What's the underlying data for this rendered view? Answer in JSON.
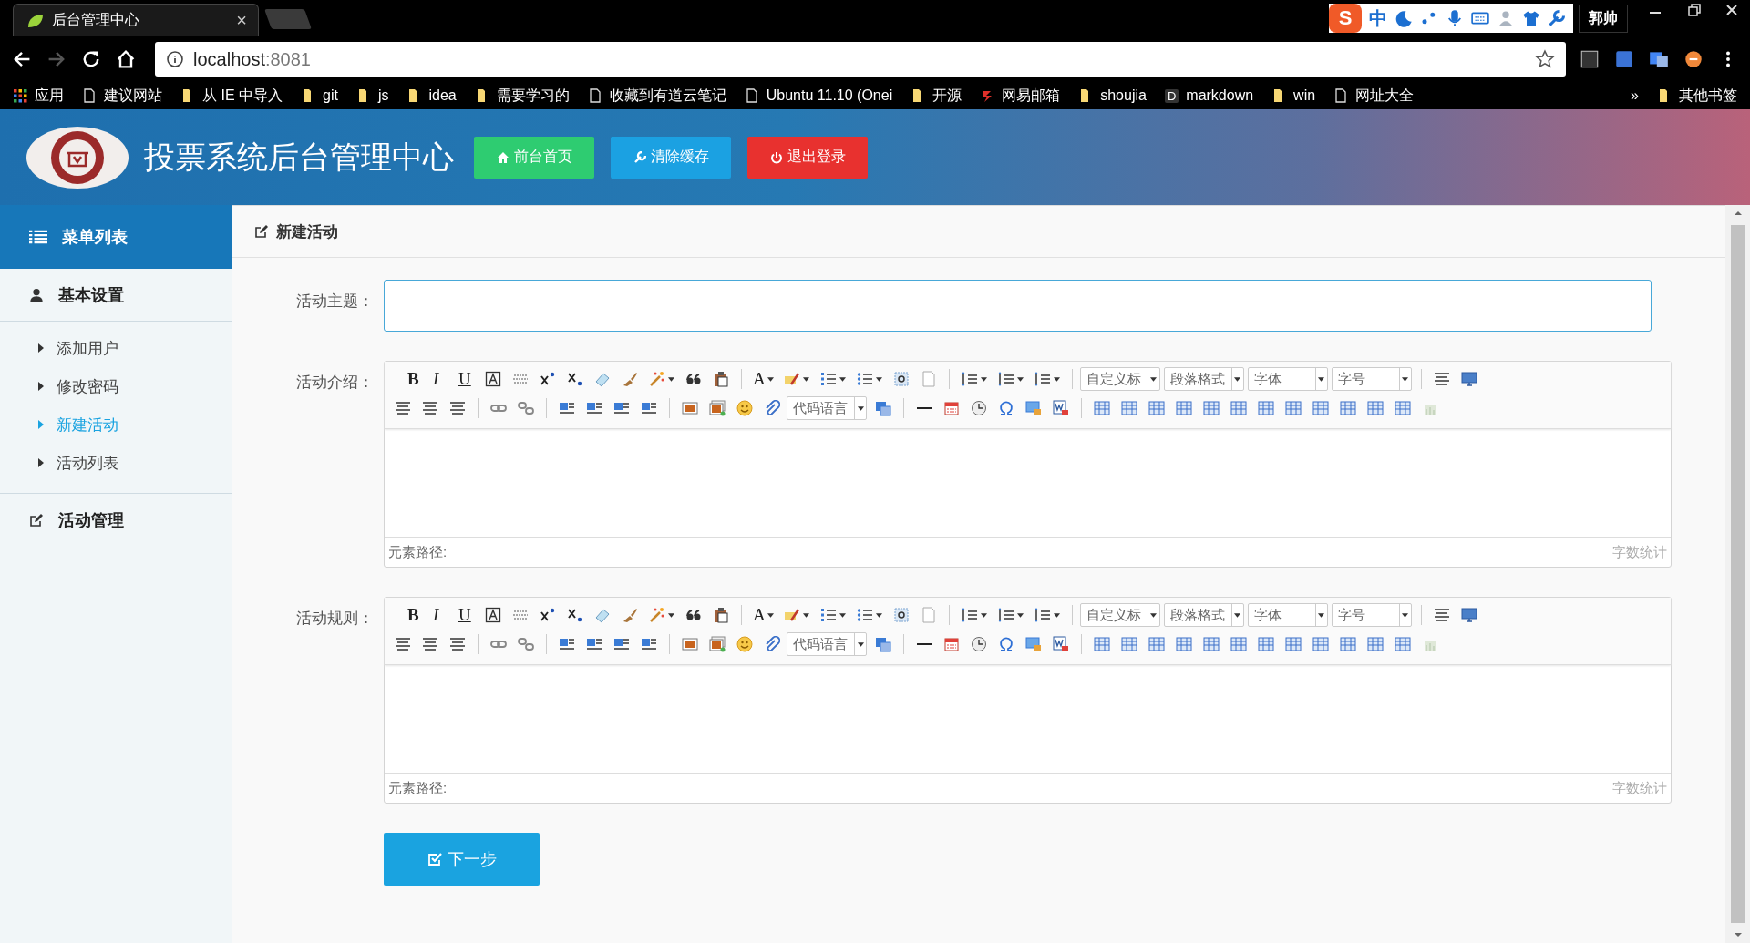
{
  "browser": {
    "tab": {
      "title": "后台管理中心",
      "close": "×"
    },
    "address": {
      "host": "localhost",
      "port": ":8081"
    },
    "bookmarks": [
      {
        "kind": "apps",
        "label": "应用"
      },
      {
        "kind": "page",
        "label": "建议网站"
      },
      {
        "kind": "folder",
        "label": "从 IE 中导入"
      },
      {
        "kind": "folder",
        "label": "git"
      },
      {
        "kind": "folder",
        "label": "js"
      },
      {
        "kind": "folder",
        "label": "idea"
      },
      {
        "kind": "folder",
        "label": "需要学习的"
      },
      {
        "kind": "page",
        "label": "收藏到有道云笔记"
      },
      {
        "kind": "page",
        "label": "Ubuntu 11.10 (Onei"
      },
      {
        "kind": "folder",
        "label": "开源"
      },
      {
        "kind": "mail",
        "label": "网易邮箱"
      },
      {
        "kind": "folder",
        "label": "shoujia"
      },
      {
        "kind": "letter",
        "glyph": "D",
        "label": "markdown"
      },
      {
        "kind": "folder",
        "label": "win"
      },
      {
        "kind": "page",
        "label": "网址大全"
      }
    ],
    "more": "»",
    "other_bookmarks": "其他书签",
    "ime": {
      "logo": "S",
      "mode": "中"
    },
    "user": "郭帅"
  },
  "header": {
    "title": "投票系统后台管理中心",
    "buttons": [
      {
        "label": "前台首页",
        "color": "#2ecc71"
      },
      {
        "label": "清除缓存",
        "color": "#1ba1e2"
      },
      {
        "label": "退出登录",
        "color": "#e8312f"
      }
    ]
  },
  "sidebar": {
    "title": "菜单列表",
    "sections": [
      {
        "label": "基本设置",
        "expanded": true,
        "items": [
          {
            "label": "添加用户",
            "selected": false
          },
          {
            "label": "修改密码",
            "selected": false
          },
          {
            "label": "新建活动",
            "selected": true
          },
          {
            "label": "活动列表",
            "selected": false
          }
        ]
      },
      {
        "label": "活动管理",
        "expanded": false
      }
    ]
  },
  "panel": {
    "title": "新建活动",
    "subject": {
      "label": "活动主题："
    },
    "editors": [
      {
        "label": "活动介绍：",
        "path": "元素路径:",
        "count": "字数统计",
        "rows": [
          [
            {
              "kind": "sep"
            },
            {
              "kind": "glyph",
              "text": "B",
              "caret": false
            },
            {
              "kind": "glyph",
              "text": "I",
              "caret": false
            },
            {
              "kind": "glyph",
              "text": "U",
              "caret": false
            },
            {
              "kind": "icon",
              "caret": false
            },
            {
              "kind": "icon",
              "caret": false
            },
            {
              "kind": "icon",
              "caret": false
            },
            {
              "kind": "icon",
              "caret": false
            },
            {
              "kind": "icon",
              "caret": false
            },
            {
              "kind": "icon",
              "caret": false
            },
            {
              "kind": "icon",
              "caret": true
            },
            {
              "kind": "icon",
              "caret": false
            },
            {
              "kind": "icon",
              "caret": false
            },
            {
              "kind": "sep"
            },
            {
              "kind": "glyph",
              "text": "A",
              "caret": true
            },
            {
              "kind": "icon",
              "caret": true
            },
            {
              "kind": "icon",
              "caret": true
            },
            {
              "kind": "icon",
              "caret": true
            },
            {
              "kind": "icon",
              "caret": false
            },
            {
              "kind": "icon",
              "caret": false
            },
            {
              "kind": "sep"
            },
            {
              "kind": "icon",
              "caret": true
            },
            {
              "kind": "icon",
              "caret": true
            },
            {
              "kind": "icon",
              "caret": true
            },
            {
              "kind": "sep"
            },
            {
              "kind": "select",
              "text": "自定义标"
            },
            {
              "kind": "select",
              "text": "段落格式"
            },
            {
              "kind": "select",
              "text": "字体"
            },
            {
              "kind": "select",
              "text": "字号"
            },
            {
              "kind": "sep"
            },
            {
              "kind": "icon",
              "caret": false
            },
            {
              "kind": "icon",
              "caret": false
            }
          ],
          [
            {
              "kind": "icon",
              "caret": false
            },
            {
              "kind": "icon",
              "caret": false
            },
            {
              "kind": "icon",
              "caret": false
            },
            {
              "kind": "sep"
            },
            {
              "kind": "icon",
              "caret": false
            },
            {
              "kind": "icon",
              "caret": false
            },
            {
              "kind": "sep"
            },
            {
              "kind": "icon",
              "caret": false
            },
            {
              "kind": "icon",
              "caret": false
            },
            {
              "kind": "icon",
              "caret": false
            },
            {
              "kind": "icon",
              "caret": false
            },
            {
              "kind": "sep"
            },
            {
              "kind": "icon",
              "caret": false
            },
            {
              "kind": "icon",
              "caret": false
            },
            {
              "kind": "icon",
              "caret": false
            },
            {
              "kind": "icon",
              "caret": false
            },
            {
              "kind": "select",
              "text": "代码语言"
            },
            {
              "kind": "icon",
              "caret": false
            },
            {
              "kind": "sep"
            },
            {
              "kind": "icon",
              "caret": false
            },
            {
              "kind": "icon",
              "caret": false
            },
            {
              "kind": "icon",
              "caret": false
            },
            {
              "kind": "icon",
              "caret": false
            },
            {
              "kind": "icon",
              "caret": false
            },
            {
              "kind": "icon",
              "caret": false
            },
            {
              "kind": "sep"
            },
            {
              "kind": "icon",
              "caret": false
            },
            {
              "kind": "icon",
              "caret": false
            },
            {
              "kind": "icon",
              "caret": false
            },
            {
              "kind": "icon",
              "caret": false
            },
            {
              "kind": "icon",
              "caret": false
            },
            {
              "kind": "icon",
              "caret": false
            },
            {
              "kind": "icon",
              "caret": false
            },
            {
              "kind": "icon",
              "caret": false
            },
            {
              "kind": "icon",
              "caret": false
            },
            {
              "kind": "icon",
              "caret": false
            },
            {
              "kind": "icon",
              "caret": false
            },
            {
              "kind": "icon",
              "caret": false
            },
            {
              "kind": "icon",
              "caret": false
            }
          ]
        ]
      },
      {
        "label": "活动规则：",
        "path": "元素路径:",
        "count": "字数统计",
        "rows": [
          [
            {
              "kind": "sep"
            },
            {
              "kind": "glyph",
              "text": "B",
              "caret": false
            },
            {
              "kind": "glyph",
              "text": "I",
              "caret": false
            },
            {
              "kind": "glyph",
              "text": "U",
              "caret": false
            },
            {
              "kind": "icon",
              "caret": false
            },
            {
              "kind": "icon",
              "caret": false
            },
            {
              "kind": "icon",
              "caret": false
            },
            {
              "kind": "icon",
              "caret": false
            },
            {
              "kind": "icon",
              "caret": false
            },
            {
              "kind": "icon",
              "caret": false
            },
            {
              "kind": "icon",
              "caret": true
            },
            {
              "kind": "icon",
              "caret": false
            },
            {
              "kind": "icon",
              "caret": false
            },
            {
              "kind": "sep"
            },
            {
              "kind": "glyph",
              "text": "A",
              "caret": true
            },
            {
              "kind": "icon",
              "caret": true
            },
            {
              "kind": "icon",
              "caret": true
            },
            {
              "kind": "icon",
              "caret": true
            },
            {
              "kind": "icon",
              "caret": false
            },
            {
              "kind": "icon",
              "caret": false
            },
            {
              "kind": "sep"
            },
            {
              "kind": "icon",
              "caret": true
            },
            {
              "kind": "icon",
              "caret": true
            },
            {
              "kind": "icon",
              "caret": true
            },
            {
              "kind": "sep"
            },
            {
              "kind": "select",
              "text": "自定义标"
            },
            {
              "kind": "select",
              "text": "段落格式"
            },
            {
              "kind": "select",
              "text": "字体"
            },
            {
              "kind": "select",
              "text": "字号"
            },
            {
              "kind": "sep"
            },
            {
              "kind": "icon",
              "caret": false
            },
            {
              "kind": "icon",
              "caret": false
            }
          ],
          [
            {
              "kind": "icon",
              "caret": false
            },
            {
              "kind": "icon",
              "caret": false
            },
            {
              "kind": "icon",
              "caret": false
            },
            {
              "kind": "sep"
            },
            {
              "kind": "icon",
              "caret": false
            },
            {
              "kind": "icon",
              "caret": false
            },
            {
              "kind": "sep"
            },
            {
              "kind": "icon",
              "caret": false
            },
            {
              "kind": "icon",
              "caret": false
            },
            {
              "kind": "icon",
              "caret": false
            },
            {
              "kind": "icon",
              "caret": false
            },
            {
              "kind": "sep"
            },
            {
              "kind": "icon",
              "caret": false
            },
            {
              "kind": "icon",
              "caret": false
            },
            {
              "kind": "icon",
              "caret": false
            },
            {
              "kind": "icon",
              "caret": false
            },
            {
              "kind": "select",
              "text": "代码语言"
            },
            {
              "kind": "icon",
              "caret": false
            },
            {
              "kind": "sep"
            },
            {
              "kind": "icon",
              "caret": false
            },
            {
              "kind": "icon",
              "caret": false
            },
            {
              "kind": "icon",
              "caret": false
            },
            {
              "kind": "icon",
              "caret": false
            },
            {
              "kind": "icon",
              "caret": false
            },
            {
              "kind": "icon",
              "caret": false
            },
            {
              "kind": "sep"
            },
            {
              "kind": "icon",
              "caret": false
            },
            {
              "kind": "icon",
              "caret": false
            },
            {
              "kind": "icon",
              "caret": false
            },
            {
              "kind": "icon",
              "caret": false
            },
            {
              "kind": "icon",
              "caret": false
            },
            {
              "kind": "icon",
              "caret": false
            },
            {
              "kind": "icon",
              "caret": false
            },
            {
              "kind": "icon",
              "caret": false
            },
            {
              "kind": "icon",
              "caret": false
            },
            {
              "kind": "icon",
              "caret": false
            },
            {
              "kind": "icon",
              "caret": false
            },
            {
              "kind": "icon",
              "caret": false
            },
            {
              "kind": "icon",
              "caret": false
            }
          ]
        ]
      }
    ],
    "next_button": "下一步"
  }
}
